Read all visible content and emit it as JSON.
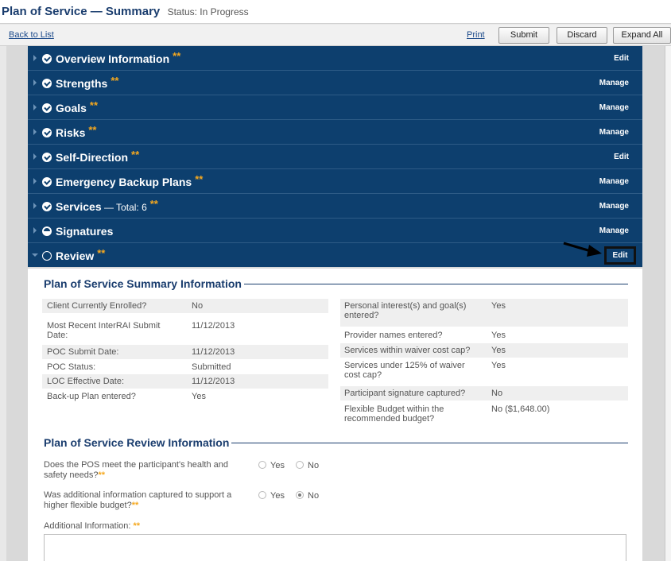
{
  "header": {
    "title": "Plan of Service — Summary",
    "status": "Status: In Progress"
  },
  "toolbar": {
    "back": "Back to List",
    "print": "Print",
    "submit": "Submit",
    "discard": "Discard",
    "expand_all": "Expand All"
  },
  "sections": [
    {
      "name": "Overview Information",
      "sub": "",
      "stars": "**",
      "action": "Edit",
      "state": "complete"
    },
    {
      "name": "Strengths",
      "sub": "",
      "stars": "**",
      "action": "Manage",
      "state": "complete"
    },
    {
      "name": "Goals",
      "sub": "",
      "stars": "**",
      "action": "Manage",
      "state": "complete"
    },
    {
      "name": "Risks",
      "sub": "",
      "stars": "**",
      "action": "Manage",
      "state": "complete"
    },
    {
      "name": "Self-Direction",
      "sub": "",
      "stars": "**",
      "action": "Edit",
      "state": "complete"
    },
    {
      "name": "Emergency Backup Plans",
      "sub": "",
      "stars": "**",
      "action": "Manage",
      "state": "complete"
    },
    {
      "name": "Services",
      "sub": " — Total: 6",
      "stars": "**",
      "action": "Manage",
      "state": "complete"
    },
    {
      "name": "Signatures",
      "sub": "",
      "stars": "",
      "action": "Manage",
      "state": "partial"
    },
    {
      "name": "Review",
      "sub": "",
      "stars": "**",
      "action": "Edit",
      "state": "open"
    }
  ],
  "summary": {
    "heading": "Plan of Service Summary Information",
    "left": [
      {
        "label": "Client Currently Enrolled?",
        "value": "No"
      },
      {
        "label": "Most Recent InterRAI Submit Date:",
        "value": "11/12/2013"
      },
      {
        "label": "POC Submit Date:",
        "value": "11/12/2013"
      },
      {
        "label": "POC Status:",
        "value": "Submitted"
      },
      {
        "label": "LOC Effective Date:",
        "value": "11/12/2013"
      },
      {
        "label": "Back-up Plan entered?",
        "value": "Yes"
      }
    ],
    "right": [
      {
        "label": "Personal interest(s) and goal(s) entered?",
        "value": "Yes"
      },
      {
        "label": "Provider names entered?",
        "value": "Yes"
      },
      {
        "label": "Services within waiver cost cap?",
        "value": "Yes"
      },
      {
        "label": "Services under 125% of waiver cost cap?",
        "value": "Yes"
      },
      {
        "label": "Participant signature captured?",
        "value": "No"
      },
      {
        "label": "Flexible Budget within the recommended budget?",
        "value": "No ($1,648.00)"
      }
    ]
  },
  "review": {
    "heading": "Plan of Service Review Information",
    "questions": [
      {
        "text": "Does the POS meet the participant's health and safety needs?",
        "stars": "**",
        "yes": "Yes",
        "no": "No",
        "selected": ""
      },
      {
        "text": "Was additional information captured to support a higher flexible budget?",
        "stars": "**",
        "yes": "Yes",
        "no": "No",
        "selected": "No"
      }
    ],
    "additional_label": "Additional Information:",
    "additional_stars": "**",
    "additional_value": ""
  },
  "colors": {
    "section_bg": "#0d3f6e",
    "required_star": "#f5a81f",
    "heading": "#1a3d6e"
  }
}
